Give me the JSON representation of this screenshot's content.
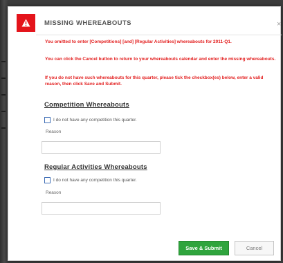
{
  "dialog": {
    "title": "MISSING WHEREABOUTS",
    "close_symbol": "×",
    "alert_icon": "warning-triangle-icon",
    "alert_color": "#e4141b"
  },
  "messages": [
    "You omitted to enter [Competitions] [and] [Regular Activities] whereabouts for 2011-Q1.",
    "You can click the Cancel button to return to your whereabouts calendar and enter the missing whereabouts.",
    "If you do not have such whereabouts for this quarter, please tick the checkbox(es) below, enter a valid reason, then click Save and Submit."
  ],
  "competition": {
    "title": "Competition Whereabouts",
    "checkbox_label": "I do not have any competition this quarter.",
    "reason_label": "Reason",
    "reason_value": ""
  },
  "regular": {
    "title": "Regular Activities Whereabouts",
    "checkbox_label": "I do not have any competition this quarter.",
    "reason_label": "Reason",
    "reason_value": ""
  },
  "buttons": {
    "submit": "Save & Submit",
    "cancel": "Cancel"
  },
  "colors": {
    "message_text": "#e32020",
    "submit_bg": "#2fa43d"
  }
}
